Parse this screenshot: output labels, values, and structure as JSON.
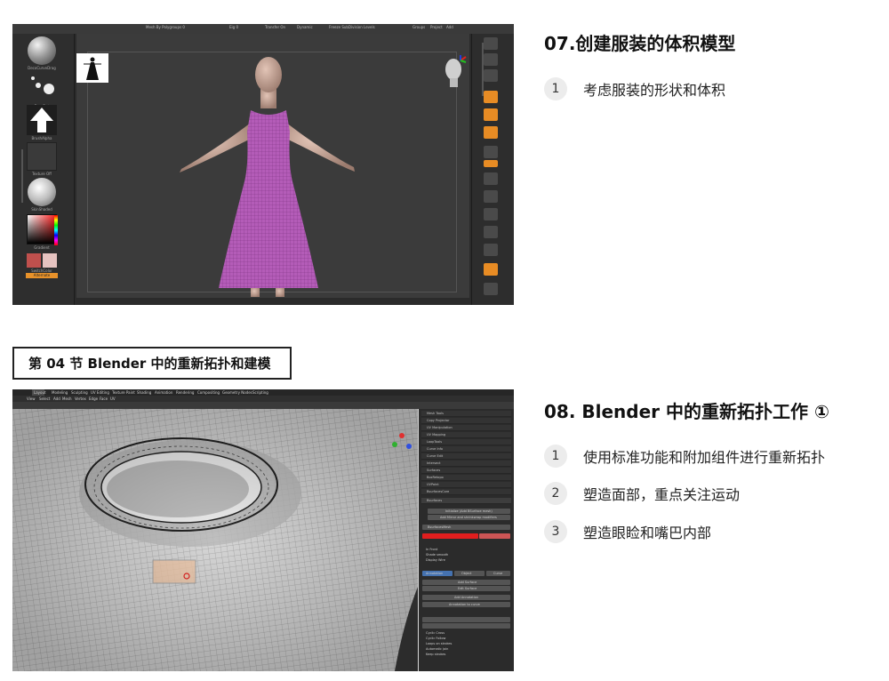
{
  "zbrush": {
    "menu": [
      "Mesh By Polygroups 0",
      "Eig 0",
      "Transfer On",
      "Dynamic",
      "Freeze SubDivision Levels",
      "Groups",
      "Project",
      "Add"
    ],
    "left_labels": [
      "DecoCurveDrag",
      "DragDot",
      "BrushAlpha",
      "Texture Off",
      "SkinShaded",
      "Gradient",
      "SwitchColor",
      "Alternate"
    ],
    "colors": {
      "dress": "#b45cb8",
      "skin": "#c9a99a",
      "swatch_main": "#c0504d",
      "swatch_alt": "#e6c3c0",
      "accent": "#e88c24"
    }
  },
  "blender": {
    "menu": [
      "View",
      "Select",
      "Add",
      "Mesh",
      "Vertex",
      "Edge",
      "Face",
      "UV"
    ],
    "workspace_tabs": [
      "Layout",
      "Modeling",
      "Sculpting",
      "UV Editing",
      "Texture Paint",
      "Shading",
      "Animation",
      "Rendering",
      "Compositing",
      "Geometry Nodes",
      "Scripting"
    ],
    "panel_rows": [
      "Mesh Tools",
      "Copy Projector",
      "UV Manipulation",
      "UV Mapping",
      "LoopTools",
      "Curve Info",
      "Curve Edit",
      "Intersect",
      "Surfaces",
      "BoxRetopo",
      "UVPaint",
      "BsurfacesCore",
      "Bsurfaces"
    ],
    "panel_buttons": [
      "Initialize (Add BSurface mesh)",
      "Add Mirror and shrinkwrap modifiers",
      "BsurfacesMesh",
      "Annotation",
      "Object",
      "Curve",
      "Add Surface",
      "Edit Surface",
      "Add Annotation",
      "Annotation to curve"
    ],
    "panel_checks": [
      "In Front",
      "Shade smooth",
      "Display Wire",
      "Cyclic Cross",
      "Cyclic Follow",
      "Loops on strokes",
      "Automatic join",
      "Keep strokes"
    ],
    "colors": {
      "mesh_bg": "#d8d8d8",
      "wire": "#2a2a2a",
      "face_select": "#f0b48a",
      "accent_blue": "#4572b0"
    }
  },
  "section07": {
    "title": "07.创建服装的体积模型",
    "items": [
      {
        "num": "1",
        "text": "考虑服装的形状和体积"
      }
    ]
  },
  "section_label": "第 04 节 Blender 中的重新拓扑和建模",
  "section08": {
    "title": "08. Blender 中的重新拓扑工作 ①",
    "items": [
      {
        "num": "1",
        "text": "使用标准功能和附加组件进行重新拓扑"
      },
      {
        "num": "2",
        "text": "塑造面部，重点关注运动"
      },
      {
        "num": "3",
        "text": "塑造眼睑和嘴巴内部"
      }
    ]
  }
}
